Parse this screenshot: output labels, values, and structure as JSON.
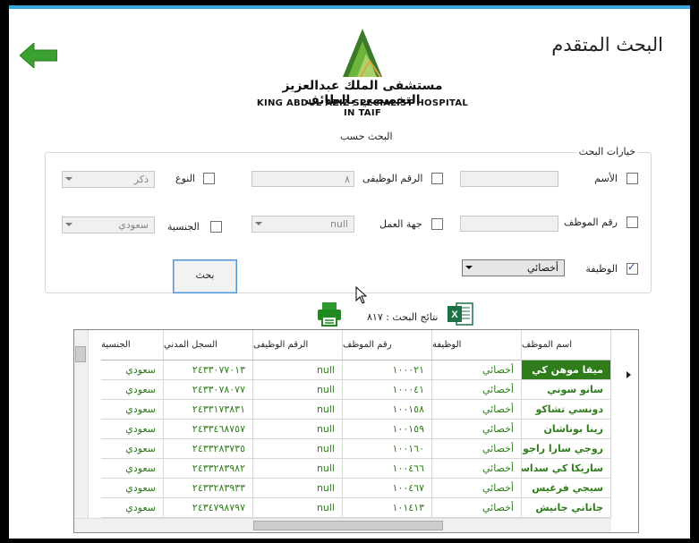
{
  "window": {
    "title": "البحث المتقدم"
  },
  "logo": {
    "arabic": "مستشفى الملك عبدالعزيز التخصصي بالطائف",
    "english": "KING ABDUL AZIZ SPECIALIST HOSPITAL IN TAIF"
  },
  "search": {
    "caption": "البحث حسب",
    "group_title": "خيارات البحث",
    "fields": {
      "name_label": "الأسم",
      "name_value": "",
      "employee_no_label": "رقم الموظف",
      "employee_no_value": "",
      "job_label": "الوظيفة",
      "job_value": "أخصائي",
      "job_id_label": "الرقم الوظيفى",
      "job_id_value": "٨",
      "work_dept_label": "جهة العمل",
      "work_dept_value": "null",
      "gender_label": "النوع",
      "gender_value": "ذكر",
      "nationality_label": "الجنسية",
      "nationality_value": "سعودي"
    },
    "button": "بحث"
  },
  "results": {
    "label": "نتائج البحث : ٨١٧",
    "columns": [
      "اسم الموظف",
      "الوظيفة",
      "رقم الموظف",
      "الرقم الوظيفى",
      "السجل المدني",
      "الجنسية"
    ],
    "rows": [
      [
        "ميقا موهن كي",
        "أخصائي",
        "١٠٠٠٢١",
        "null",
        "٢٤٣٣٠٧٧٠١٣",
        "سعودي"
      ],
      [
        "سانو سوني",
        "أخصائي",
        "١٠٠٠٤١",
        "null",
        "٢٤٣٣٠٧٨٠٧٧",
        "سعودي"
      ],
      [
        "دونسي تشاكو",
        "أخصائي",
        "١٠٠١٥٨",
        "null",
        "٢٤٣٣١٧٣٨٣١",
        "سعودي"
      ],
      [
        "رينا بوناشان",
        "أخصائي",
        "١٠٠١٥٩",
        "null",
        "٢٤٣٣٤٦٨٧٥٧",
        "سعودي"
      ],
      [
        "روجي سارا راجو",
        "أخصائي",
        "١٠٠١٦٠",
        "null",
        "٢٤٣٣٢٨٣٧٣٥",
        "سعودي"
      ],
      [
        "ساريكا كي سداسيفان",
        "أخصائي",
        "١٠٠٤٦٦",
        "null",
        "٢٤٣٣٢٨٣٩٨٢",
        "سعودي"
      ],
      [
        "سيجي فرغيس",
        "أخصائي",
        "١٠٠٤٦٧",
        "null",
        "٢٤٣٣٢٨٣٩٣٣",
        "سعودي"
      ],
      [
        "جاناني جانيش",
        "أخصائي",
        "١٠١٤١٣",
        "null",
        "٢٤٣٤٧٩٨٧٩٧",
        "سعودي"
      ]
    ]
  },
  "icons": {
    "back": "back-arrow-icon",
    "print": "printer-icon",
    "excel": "excel-icon"
  },
  "colors": {
    "accent": "#2e7d1a",
    "title_bar": "#3aa8e0",
    "back_arrow": "#3aa030"
  }
}
